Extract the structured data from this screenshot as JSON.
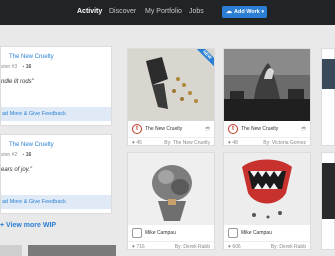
{
  "nav": {
    "items": [
      {
        "label": "Activity",
        "active": true
      },
      {
        "label": "Discover",
        "active": false
      },
      {
        "label": "My Portfolio",
        "active": false
      },
      {
        "label": "Jobs",
        "active": false
      }
    ],
    "add_work_label": "Add Work",
    "add_work_icon": "cloud-upload-icon",
    "accent": "#2a7fd4"
  },
  "wip": {
    "cards": [
      {
        "title": "The New Cruelty",
        "revision": "sion #3",
        "comments": "16",
        "quote": "ndle lit rods\"",
        "read_more": "ad More & Give Feedback"
      },
      {
        "title": "The New Cruelty",
        "revision": "sion #2",
        "comments": "16",
        "quote": "ears of joy.\"",
        "read_more": "ad More & Give Feedback"
      }
    ],
    "view_more": "+ View more WIP"
  },
  "grid": [
    {
      "owner": "The New Cruelty",
      "likes": "45",
      "by": "By: The New Cruelty",
      "badge": "NEW",
      "logo": "TNC"
    },
    {
      "owner": "The New Cruelty",
      "likes": "48",
      "by": "By: Victoria Gomez",
      "logo": "TNC"
    },
    {
      "owner": "Mike Campau",
      "likes": "716",
      "by": "By: Derek Rabb"
    },
    {
      "owner": "Mike Campau",
      "likes": "606",
      "by": "By: Derek Rabb"
    }
  ]
}
